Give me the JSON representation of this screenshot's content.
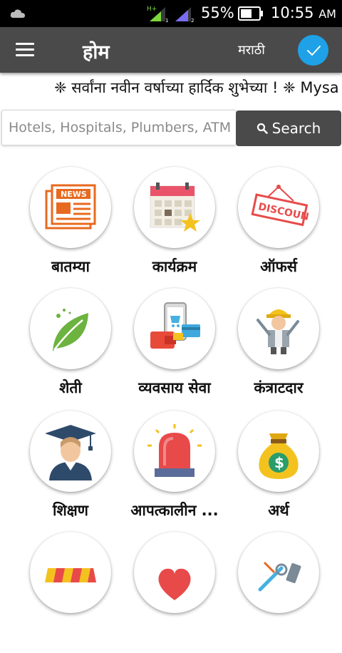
{
  "status_bar": {
    "network_type": "H+",
    "sim1": "1",
    "sim2": "2",
    "battery": "55%",
    "time": "10:55",
    "ampm": "AM"
  },
  "toolbar": {
    "title": "होम",
    "language_label": "मराठी"
  },
  "marquee": {
    "text": "❈ सर्वांना नवीन वर्षाच्या हार्दिक शुभेच्या ! ❈ Mysa"
  },
  "search": {
    "placeholder": "Hotels, Hospitals, Plumbers, ATM",
    "button_label": "Search"
  },
  "categories": [
    {
      "label": "बातम्या",
      "icon": "newspaper-icon"
    },
    {
      "label": "कार्यक्रम",
      "icon": "calendar-icon"
    },
    {
      "label": "ऑफर्स",
      "icon": "discount-tag-icon"
    },
    {
      "label": "शेती",
      "icon": "leaf-icon"
    },
    {
      "label": "व्यवसाय सेवा",
      "icon": "mobile-payment-icon"
    },
    {
      "label": "कंत्राटदार",
      "icon": "worker-icon"
    },
    {
      "label": "शिक्षण",
      "icon": "graduate-icon"
    },
    {
      "label": "आपत्कालीन ...",
      "icon": "siren-icon"
    },
    {
      "label": "अर्थ",
      "icon": "money-bag-icon"
    },
    {
      "label": "",
      "icon": "shop-awning-icon"
    },
    {
      "label": "",
      "icon": "heart-icon"
    },
    {
      "label": "",
      "icon": "tools-icon"
    }
  ],
  "colors": {
    "toolbar": "#4a4a4a",
    "accent": "#1fa1e8",
    "status_bar": "#000000"
  }
}
